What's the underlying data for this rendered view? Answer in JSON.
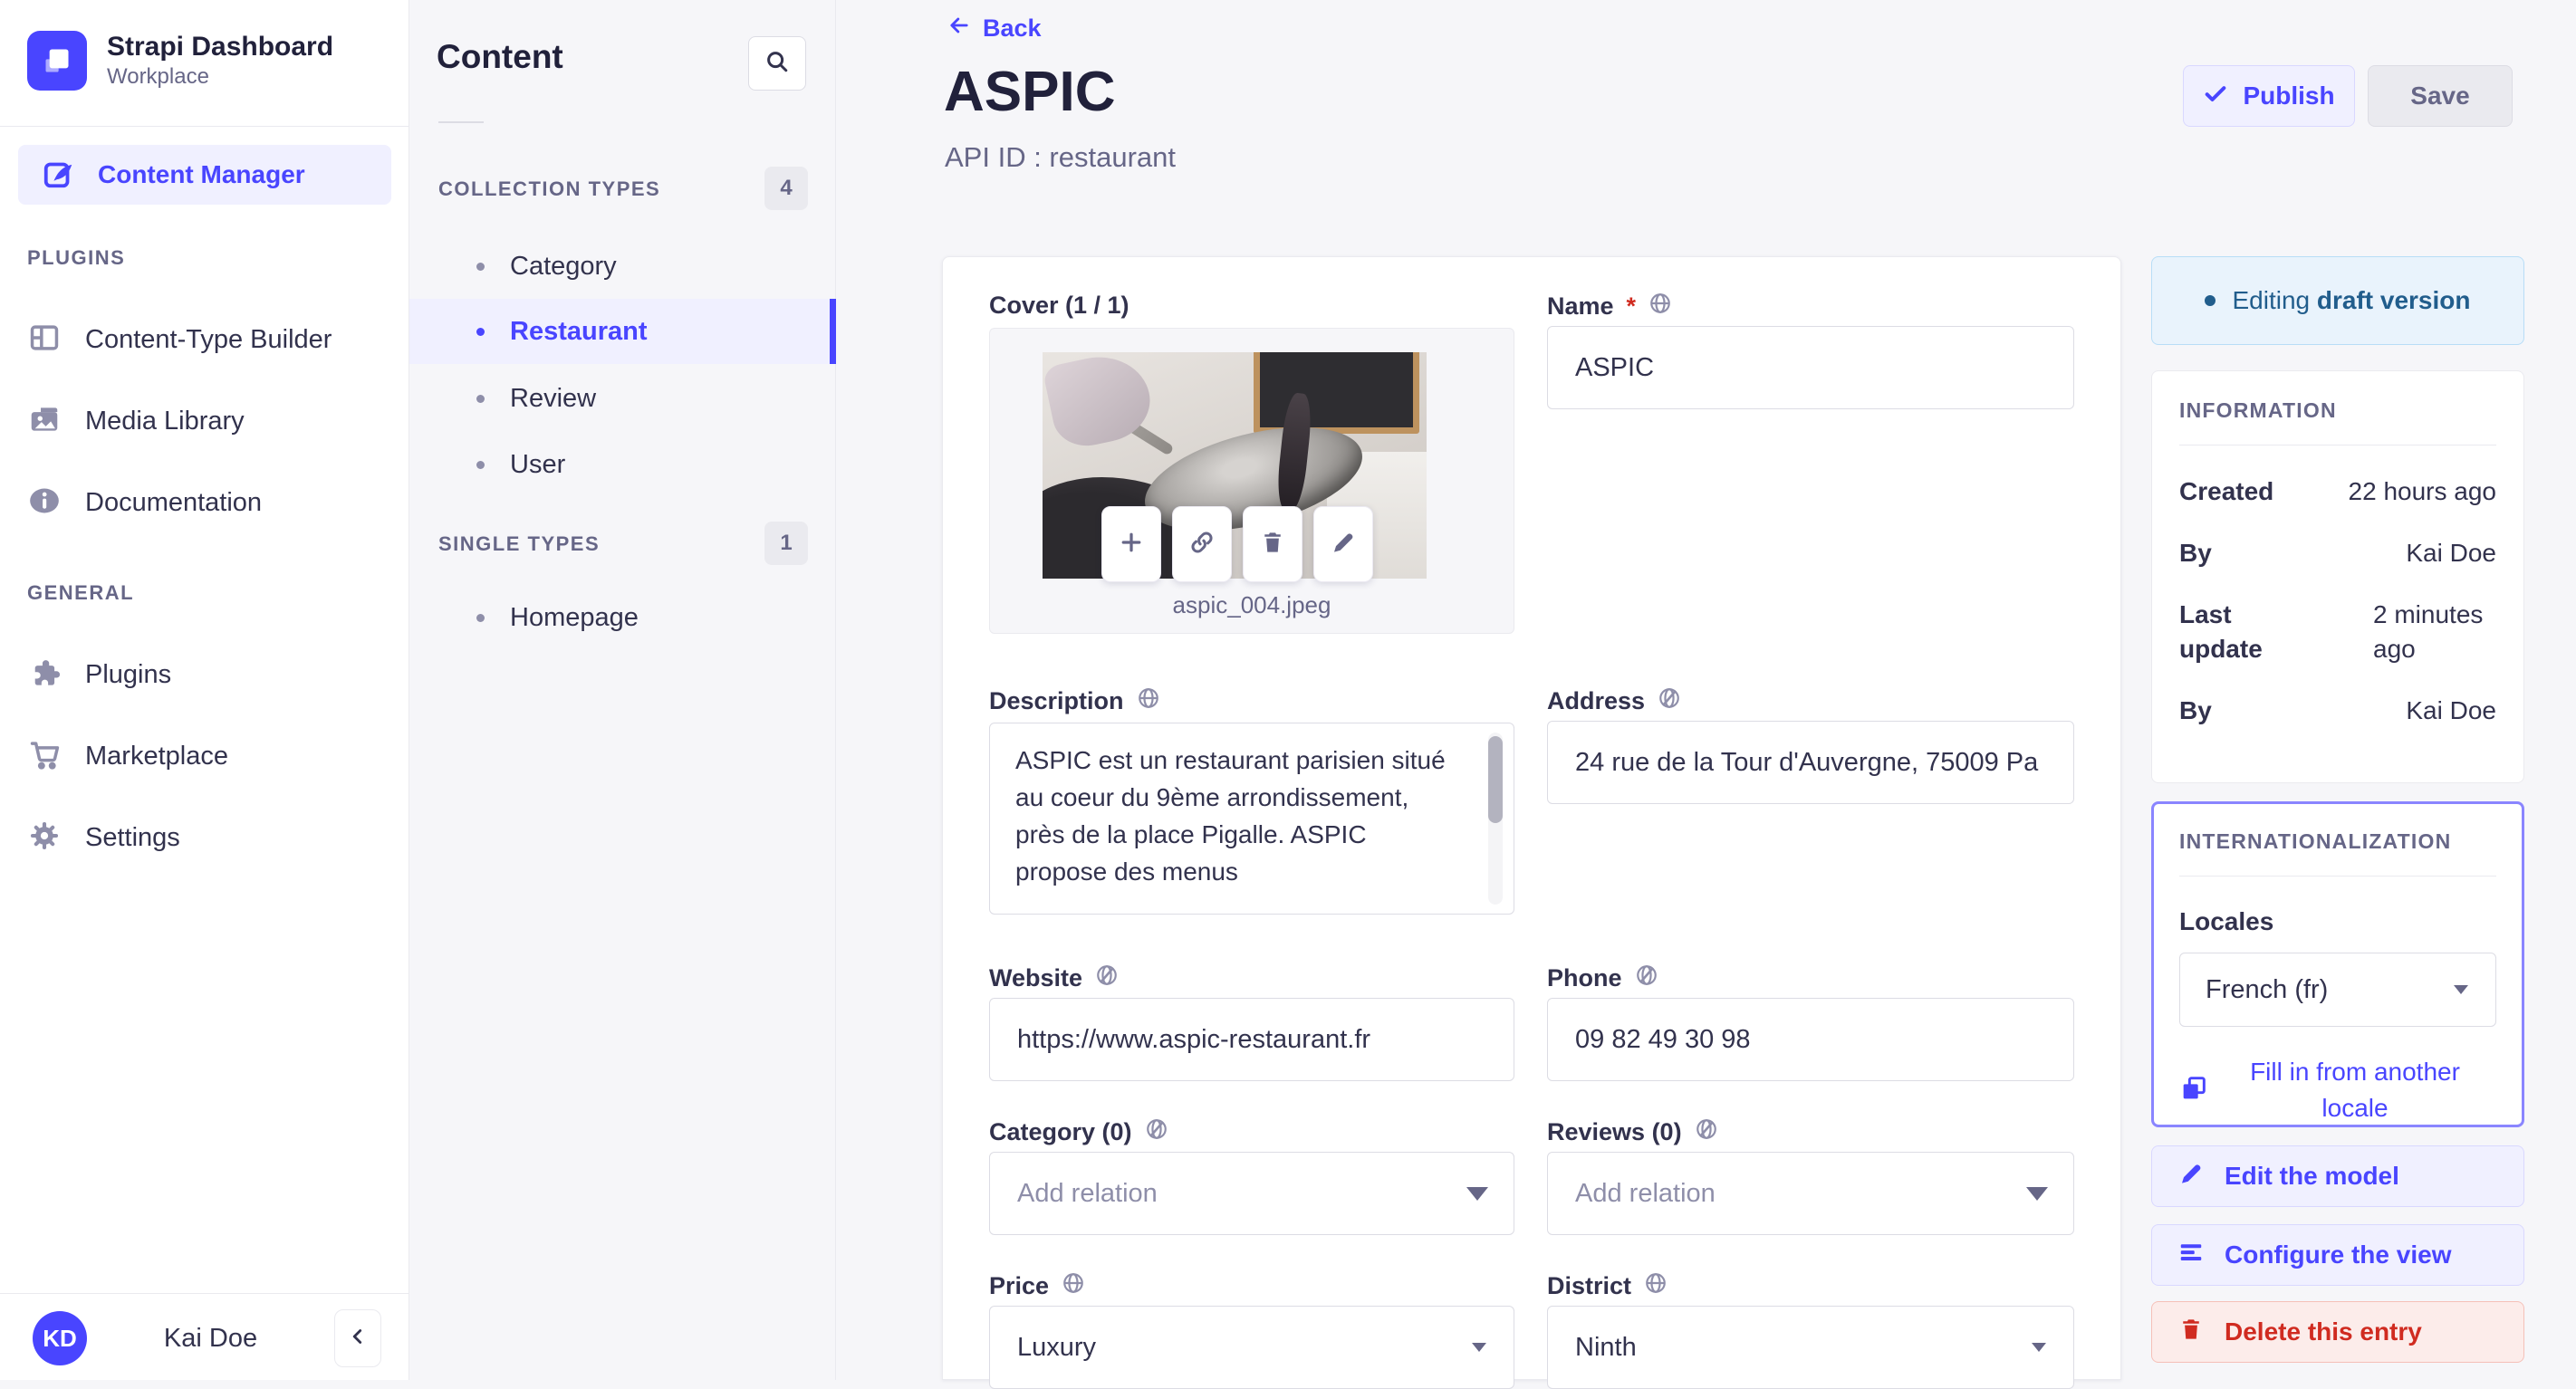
{
  "colors": {
    "primary": "#4945ff",
    "primary_light_bg": "#f0f0ff",
    "danger": "#d02b20",
    "danger_light_bg": "#fcecea",
    "draft_text": "#215d8c",
    "draft_bg": "#e9f3fc",
    "highlight_border": "#8a85ff",
    "text_dark": "#32324d",
    "text_gray": "#666687"
  },
  "app": {
    "title": "Strapi Dashboard",
    "workspace": "Workplace"
  },
  "sidebar": {
    "active_item": {
      "label": "Content Manager"
    },
    "sections": [
      {
        "title": "PLUGINS",
        "items": [
          {
            "label": "Content-Type Builder"
          },
          {
            "label": "Media Library"
          },
          {
            "label": "Documentation"
          }
        ]
      },
      {
        "title": "GENERAL",
        "items": [
          {
            "label": "Plugins"
          },
          {
            "label": "Marketplace"
          },
          {
            "label": "Settings"
          }
        ]
      }
    ],
    "user": {
      "initials": "KD",
      "name": "Kai Doe"
    }
  },
  "content_nav": {
    "title": "Content",
    "collection_types": {
      "label": "COLLECTION TYPES",
      "count": "4",
      "items": [
        {
          "label": "Category"
        },
        {
          "label": "Restaurant"
        },
        {
          "label": "Review"
        },
        {
          "label": "User"
        }
      ],
      "active": "Restaurant"
    },
    "single_types": {
      "label": "SINGLE TYPES",
      "count": "1",
      "items": [
        {
          "label": "Homepage"
        }
      ]
    }
  },
  "header": {
    "back_label": "Back",
    "title": "ASPIC",
    "api_id": "API ID : restaurant",
    "publish_label": "Publish",
    "save_label": "Save"
  },
  "form": {
    "cover": {
      "label": "Cover (1 / 1)",
      "filename": "aspic_004.jpeg"
    },
    "name": {
      "label": "Name",
      "required_mark": "*",
      "value": "ASPIC"
    },
    "description": {
      "label": "Description",
      "value": "ASPIC est un restaurant parisien situé au coeur du 9ème arrondissement, près de la place Pigalle. ASPIC propose des menus"
    },
    "address": {
      "label": "Address",
      "value": "24 rue de la Tour d'Auvergne, 75009 Pa"
    },
    "website": {
      "label": "Website",
      "value": "https://www.aspic-restaurant.fr"
    },
    "phone": {
      "label": "Phone",
      "value": "09 82 49 30 98"
    },
    "category": {
      "label": "Category (0)",
      "placeholder": "Add relation"
    },
    "reviews": {
      "label": "Reviews (0)",
      "placeholder": "Add relation"
    },
    "price": {
      "label": "Price",
      "value": "Luxury"
    },
    "district": {
      "label": "District",
      "value": "Ninth"
    }
  },
  "status_box": {
    "prefix": "Editing",
    "emphasis": "draft version"
  },
  "information": {
    "title": "INFORMATION",
    "rows": [
      {
        "label": "Created",
        "value": "22 hours ago"
      },
      {
        "label": "By",
        "value": "Kai Doe"
      },
      {
        "label": "Last update",
        "value": "2 minutes ago"
      },
      {
        "label": "By",
        "value": "Kai Doe"
      }
    ]
  },
  "internationalization": {
    "title": "INTERNATIONALIZATION",
    "locales_label": "Locales",
    "locale_value": "French (fr)",
    "fill_label": "Fill in from another locale"
  },
  "entry_actions": {
    "edit_model": "Edit the model",
    "configure_view": "Configure the view",
    "delete_entry": "Delete this entry"
  }
}
